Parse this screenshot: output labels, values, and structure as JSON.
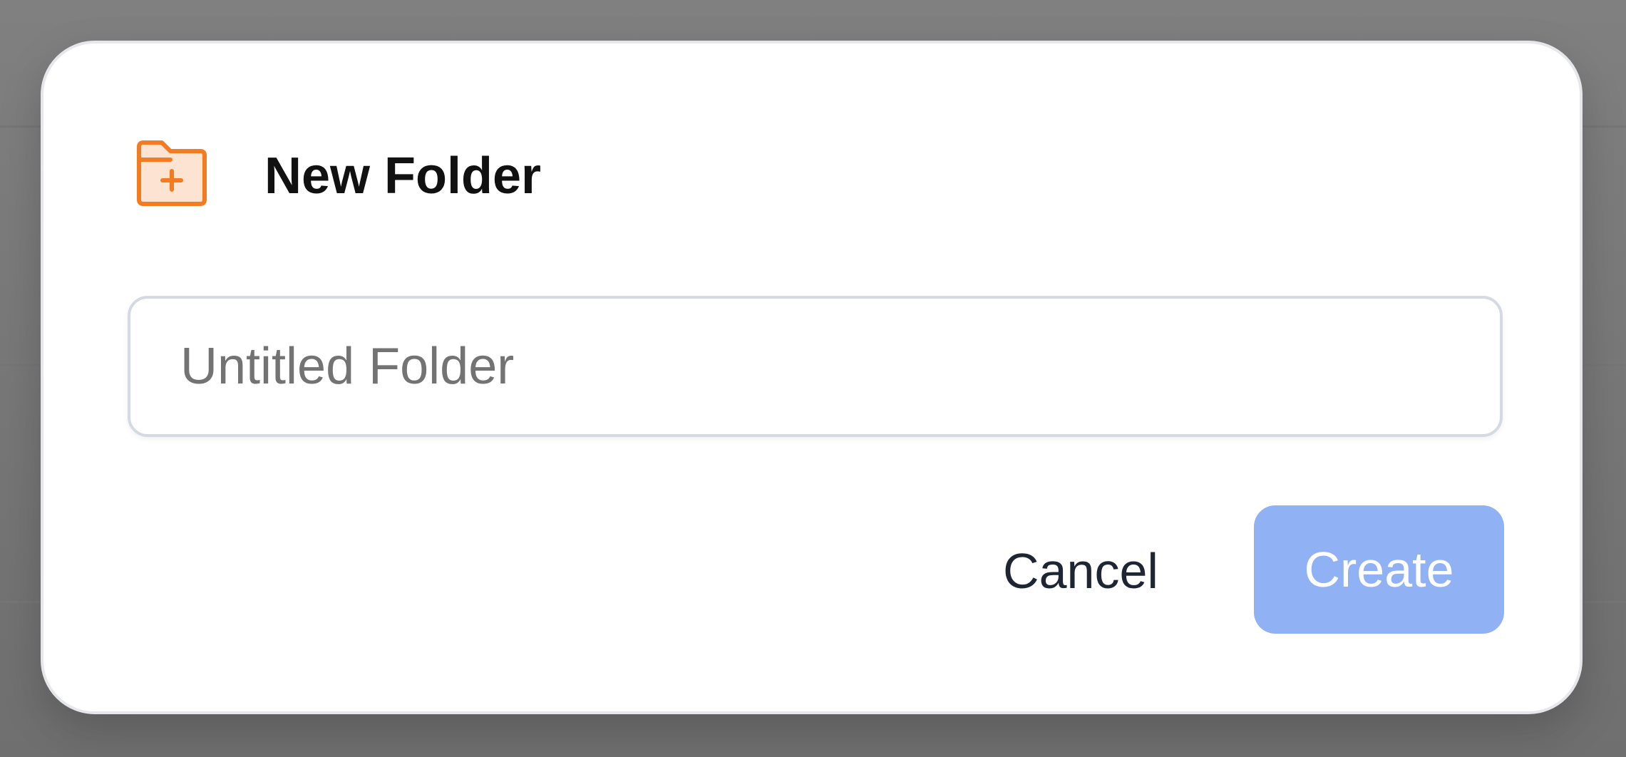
{
  "dialog": {
    "title": "New Folder",
    "icon": "folder-plus-icon",
    "input": {
      "value": "",
      "placeholder": "Untitled Folder"
    },
    "cancel_label": "Cancel",
    "create_label": "Create",
    "create_disabled": true
  },
  "colors": {
    "accent_icon": "#f47b20",
    "icon_fill": "#fde3d1",
    "primary_button_disabled": "#90b1f3",
    "overlay": "#7d7d7d"
  }
}
